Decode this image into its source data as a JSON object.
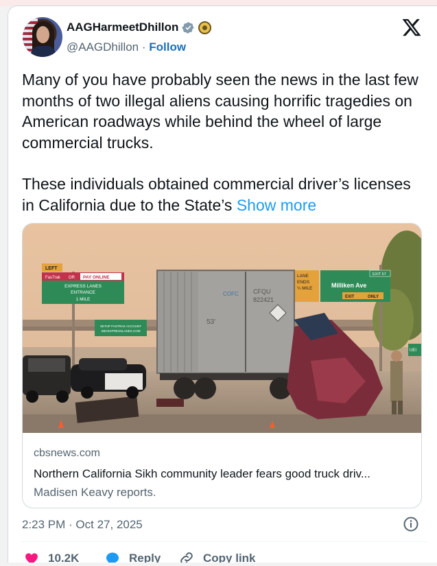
{
  "author": {
    "name": "AAGHarmeetDhillon",
    "handle": "@AAGDhillon",
    "separator": "·",
    "follow_label": "Follow"
  },
  "tweet": {
    "paragraph1": "Many of you have probably seen the news in the last few months of two illegal aliens causing horrific tragedies on American roadways while behind the wheel of large commercial trucks.",
    "paragraph2": "These individuals obtained commercial driver’s licenses in California due to the State’s",
    "show_more": "Show more"
  },
  "media": {
    "signs": {
      "left": "LEFT",
      "fastrak": "FasTrak",
      "or": "OR",
      "pay_online": "PAY ONLINE",
      "express_lanes": "EXPRESS LANES",
      "entrance": "ENTRANCE",
      "distance": "1 MILE",
      "setup1": "SETUP FASTRAK ACCOUNT",
      "setup2": "SBCEXPRESSLANES.COM",
      "lane_ends1": "LANE",
      "lane_ends2": "ENDS",
      "lane_ends3": "¼ MILE",
      "exit_num": "EXIT 57",
      "milliken": "Milliken Ave",
      "exit_only": "EXIT",
      "only": "ONLY",
      "container_code": "CFQU",
      "container_num": "822421",
      "container_brand": "COFC",
      "trailer_num": "53'",
      "right_sign": "UEI"
    },
    "domain": "cbsnews.com",
    "title": "Northern California Sikh community leader fears good truck driv...",
    "description": "Madisen Keavy reports."
  },
  "meta": {
    "timestamp": "2:23 PM · Oct 27, 2025"
  },
  "actions": {
    "likes": "10.2K",
    "reply": "Reply",
    "copy_link": "Copy link"
  },
  "colors": {
    "like_red": "#f91880",
    "reply_blue": "#1d9bf0",
    "link_blue": "#1d9bf0",
    "follow_blue": "#1d6fb8",
    "verified_gray": "#829aab"
  }
}
